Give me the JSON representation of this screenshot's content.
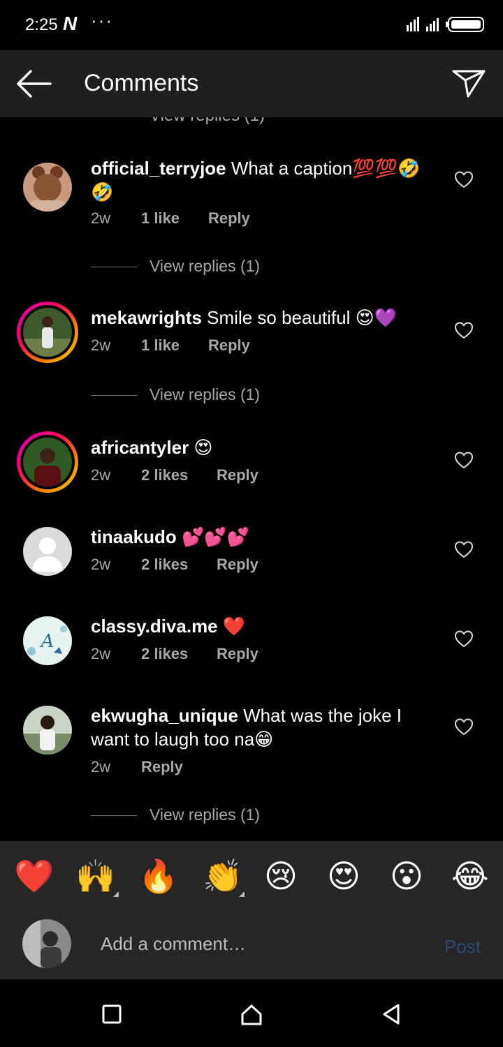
{
  "status": {
    "time": "2:25",
    "app_badge": "N",
    "dots": "···"
  },
  "header": {
    "title": "Comments"
  },
  "partial_replies": "View replies (1)",
  "comments": [
    {
      "user": "official_terryjoe",
      "text": " What a caption💯💯🤣🤣",
      "time": "2w",
      "likes": "1 like",
      "reply": "Reply",
      "view_replies": "View replies (1)"
    },
    {
      "user": "mekawrights",
      "text": " Smile so beautiful 😍💜",
      "time": "2w",
      "likes": "1 like",
      "reply": "Reply",
      "view_replies": "View replies (1)"
    },
    {
      "user": "africantyler",
      "text": " 😍",
      "time": "2w",
      "likes": "2 likes",
      "reply": "Reply"
    },
    {
      "user": "tinaakudo",
      "text": " 💕💕💕",
      "time": "2w",
      "likes": "2 likes",
      "reply": "Reply"
    },
    {
      "user": "classy.diva.me",
      "text": " ❤️",
      "time": "2w",
      "likes": "2 likes",
      "reply": "Reply"
    },
    {
      "user": "ekwugha_unique",
      "text": " What was the joke I want to laugh too na😁",
      "time": "2w",
      "reply": "Reply",
      "view_replies": "View replies (1)"
    }
  ],
  "reactions": [
    "❤️",
    "🙌",
    "🔥",
    "👏",
    "😢",
    "😍",
    "😮",
    "😂"
  ],
  "composer": {
    "placeholder": "Add a comment…",
    "post_label": "Post"
  },
  "colors": {
    "ring_start": "#d300c5",
    "ring_end": "#ffd600",
    "post_disabled": "#2b4a72",
    "bar_bg": "#262626"
  }
}
